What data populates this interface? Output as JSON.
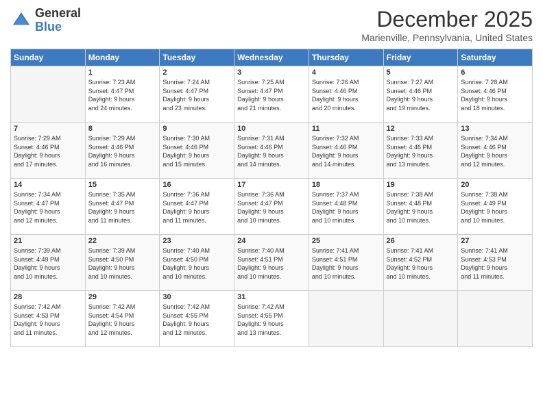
{
  "header": {
    "logo_line1": "General",
    "logo_line2": "Blue",
    "title": "December 2025",
    "location": "Marienville, Pennsylvania, United States"
  },
  "columns": [
    "Sunday",
    "Monday",
    "Tuesday",
    "Wednesday",
    "Thursday",
    "Friday",
    "Saturday"
  ],
  "weeks": [
    [
      {
        "day": "",
        "info": ""
      },
      {
        "day": "1",
        "info": "Sunrise: 7:23 AM\nSunset: 4:47 PM\nDaylight: 9 hours\nand 24 minutes."
      },
      {
        "day": "2",
        "info": "Sunrise: 7:24 AM\nSunset: 4:47 PM\nDaylight: 9 hours\nand 23 minutes."
      },
      {
        "day": "3",
        "info": "Sunrise: 7:25 AM\nSunset: 4:47 PM\nDaylight: 9 hours\nand 21 minutes."
      },
      {
        "day": "4",
        "info": "Sunrise: 7:26 AM\nSunset: 4:46 PM\nDaylight: 9 hours\nand 20 minutes."
      },
      {
        "day": "5",
        "info": "Sunrise: 7:27 AM\nSunset: 4:46 PM\nDaylight: 9 hours\nand 19 minutes."
      },
      {
        "day": "6",
        "info": "Sunrise: 7:28 AM\nSunset: 4:46 PM\nDaylight: 9 hours\nand 18 minutes."
      }
    ],
    [
      {
        "day": "7",
        "info": "Sunrise: 7:29 AM\nSunset: 4:46 PM\nDaylight: 9 hours\nand 17 minutes."
      },
      {
        "day": "8",
        "info": "Sunrise: 7:29 AM\nSunset: 4:46 PM\nDaylight: 9 hours\nand 16 minutes."
      },
      {
        "day": "9",
        "info": "Sunrise: 7:30 AM\nSunset: 4:46 PM\nDaylight: 9 hours\nand 15 minutes."
      },
      {
        "day": "10",
        "info": "Sunrise: 7:31 AM\nSunset: 4:46 PM\nDaylight: 9 hours\nand 14 minutes."
      },
      {
        "day": "11",
        "info": "Sunrise: 7:32 AM\nSunset: 4:46 PM\nDaylight: 9 hours\nand 14 minutes."
      },
      {
        "day": "12",
        "info": "Sunrise: 7:33 AM\nSunset: 4:46 PM\nDaylight: 9 hours\nand 13 minutes."
      },
      {
        "day": "13",
        "info": "Sunrise: 7:34 AM\nSunset: 4:46 PM\nDaylight: 9 hours\nand 12 minutes."
      }
    ],
    [
      {
        "day": "14",
        "info": "Sunrise: 7:34 AM\nSunset: 4:47 PM\nDaylight: 9 hours\nand 12 minutes."
      },
      {
        "day": "15",
        "info": "Sunrise: 7:35 AM\nSunset: 4:47 PM\nDaylight: 9 hours\nand 11 minutes."
      },
      {
        "day": "16",
        "info": "Sunrise: 7:36 AM\nSunset: 4:47 PM\nDaylight: 9 hours\nand 11 minutes."
      },
      {
        "day": "17",
        "info": "Sunrise: 7:36 AM\nSunset: 4:47 PM\nDaylight: 9 hours\nand 10 minutes."
      },
      {
        "day": "18",
        "info": "Sunrise: 7:37 AM\nSunset: 4:48 PM\nDaylight: 9 hours\nand 10 minutes."
      },
      {
        "day": "19",
        "info": "Sunrise: 7:38 AM\nSunset: 4:48 PM\nDaylight: 9 hours\nand 10 minutes."
      },
      {
        "day": "20",
        "info": "Sunrise: 7:38 AM\nSunset: 4:49 PM\nDaylight: 9 hours\nand 10 minutes."
      }
    ],
    [
      {
        "day": "21",
        "info": "Sunrise: 7:39 AM\nSunset: 4:49 PM\nDaylight: 9 hours\nand 10 minutes."
      },
      {
        "day": "22",
        "info": "Sunrise: 7:39 AM\nSunset: 4:50 PM\nDaylight: 9 hours\nand 10 minutes."
      },
      {
        "day": "23",
        "info": "Sunrise: 7:40 AM\nSunset: 4:50 PM\nDaylight: 9 hours\nand 10 minutes."
      },
      {
        "day": "24",
        "info": "Sunrise: 7:40 AM\nSunset: 4:51 PM\nDaylight: 9 hours\nand 10 minutes."
      },
      {
        "day": "25",
        "info": "Sunrise: 7:41 AM\nSunset: 4:51 PM\nDaylight: 9 hours\nand 10 minutes."
      },
      {
        "day": "26",
        "info": "Sunrise: 7:41 AM\nSunset: 4:52 PM\nDaylight: 9 hours\nand 10 minutes."
      },
      {
        "day": "27",
        "info": "Sunrise: 7:41 AM\nSunset: 4:53 PM\nDaylight: 9 hours\nand 11 minutes."
      }
    ],
    [
      {
        "day": "28",
        "info": "Sunrise: 7:42 AM\nSunset: 4:53 PM\nDaylight: 9 hours\nand 11 minutes."
      },
      {
        "day": "29",
        "info": "Sunrise: 7:42 AM\nSunset: 4:54 PM\nDaylight: 9 hours\nand 12 minutes."
      },
      {
        "day": "30",
        "info": "Sunrise: 7:42 AM\nSunset: 4:55 PM\nDaylight: 9 hours\nand 12 minutes."
      },
      {
        "day": "31",
        "info": "Sunrise: 7:42 AM\nSunset: 4:55 PM\nDaylight: 9 hours\nand 13 minutes."
      },
      {
        "day": "",
        "info": ""
      },
      {
        "day": "",
        "info": ""
      },
      {
        "day": "",
        "info": ""
      }
    ]
  ]
}
